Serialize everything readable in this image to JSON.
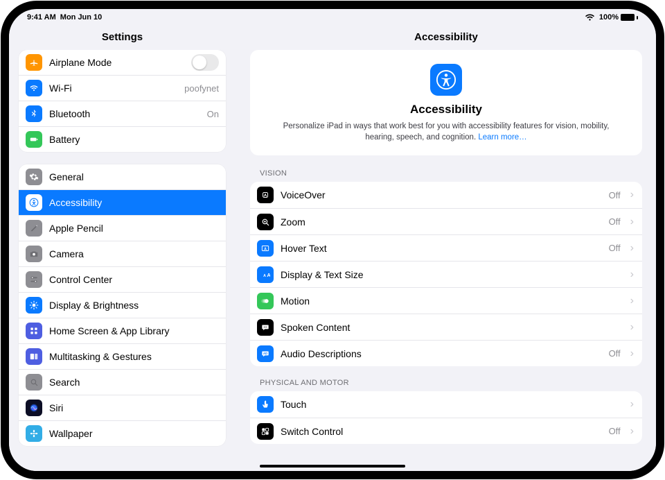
{
  "status": {
    "time": "9:41 AM",
    "date": "Mon Jun 10",
    "battery": "100%"
  },
  "sidebar": {
    "heading": "Settings",
    "group1": [
      {
        "id": "airplane",
        "label": "Airplane Mode",
        "color": "#ff9500",
        "value": "",
        "toggle": true
      },
      {
        "id": "wifi",
        "label": "Wi-Fi",
        "color": "#0a7aff",
        "value": "poofynet"
      },
      {
        "id": "bluetooth",
        "label": "Bluetooth",
        "color": "#0a7aff",
        "value": "On"
      },
      {
        "id": "battery",
        "label": "Battery",
        "color": "#34c759",
        "value": ""
      }
    ],
    "group2": [
      {
        "id": "general",
        "label": "General",
        "color": "#8e8e93"
      },
      {
        "id": "accessibility",
        "label": "Accessibility",
        "color": "#0a7aff",
        "selected": true
      },
      {
        "id": "applepencil",
        "label": "Apple Pencil",
        "color": "#8e8e93"
      },
      {
        "id": "camera",
        "label": "Camera",
        "color": "#8e8e93"
      },
      {
        "id": "controlcenter",
        "label": "Control Center",
        "color": "#8e8e93"
      },
      {
        "id": "display",
        "label": "Display & Brightness",
        "color": "#0a7aff"
      },
      {
        "id": "homescreen",
        "label": "Home Screen & App Library",
        "color": "#4e5ee1"
      },
      {
        "id": "multitask",
        "label": "Multitasking & Gestures",
        "color": "#4e5ee1"
      },
      {
        "id": "search",
        "label": "Search",
        "color": "#8e8e93"
      },
      {
        "id": "siri",
        "label": "Siri",
        "color": "grad"
      },
      {
        "id": "wallpaper",
        "label": "Wallpaper",
        "color": "#32ade6"
      }
    ]
  },
  "detail": {
    "heading": "Accessibility",
    "hero": {
      "title": "Accessibility",
      "text": "Personalize iPad in ways that work best for you with accessibility features for vision, mobility, hearing, speech, and cognition.",
      "link": "Learn more…"
    },
    "sections": [
      {
        "title": "VISION",
        "items": [
          {
            "id": "voiceover",
            "label": "VoiceOver",
            "color": "#000000",
            "value": "Off"
          },
          {
            "id": "zoom",
            "label": "Zoom",
            "color": "#000000",
            "value": "Off"
          },
          {
            "id": "hovertext",
            "label": "Hover Text",
            "color": "#0a7aff",
            "value": "Off"
          },
          {
            "id": "textsize",
            "label": "Display & Text Size",
            "color": "#0a7aff",
            "value": ""
          },
          {
            "id": "motion",
            "label": "Motion",
            "color": "#34c759",
            "value": ""
          },
          {
            "id": "spoken",
            "label": "Spoken Content",
            "color": "#000000",
            "value": ""
          },
          {
            "id": "audiodesc",
            "label": "Audio Descriptions",
            "color": "#0a7aff",
            "value": "Off"
          }
        ]
      },
      {
        "title": "PHYSICAL AND MOTOR",
        "items": [
          {
            "id": "touch",
            "label": "Touch",
            "color": "#0a7aff",
            "value": ""
          },
          {
            "id": "switchcontrol",
            "label": "Switch Control",
            "color": "#000000",
            "value": "Off"
          }
        ]
      }
    ]
  },
  "icons": {
    "airplane": "airplane-icon",
    "wifi": "wifi-icon",
    "bluetooth": "bluetooth-icon",
    "battery": "battery-icon",
    "general": "gear-icon",
    "accessibility": "accessibility-icon",
    "applepencil": "pencil-icon",
    "camera": "camera-icon",
    "controlcenter": "switches-icon",
    "display": "sun-icon",
    "homescreen": "grid-icon",
    "multitask": "panels-icon",
    "search": "search-icon",
    "siri": "siri-icon",
    "wallpaper": "flower-icon",
    "voiceover": "voiceover-icon",
    "zoom": "zoom-icon",
    "hovertext": "hovertext-icon",
    "textsize": "textsize-icon",
    "motion": "motion-icon",
    "spoken": "speechbubble-icon",
    "audiodesc": "audiodesc-icon",
    "touch": "touch-icon",
    "switchcontrol": "switch-icon"
  }
}
